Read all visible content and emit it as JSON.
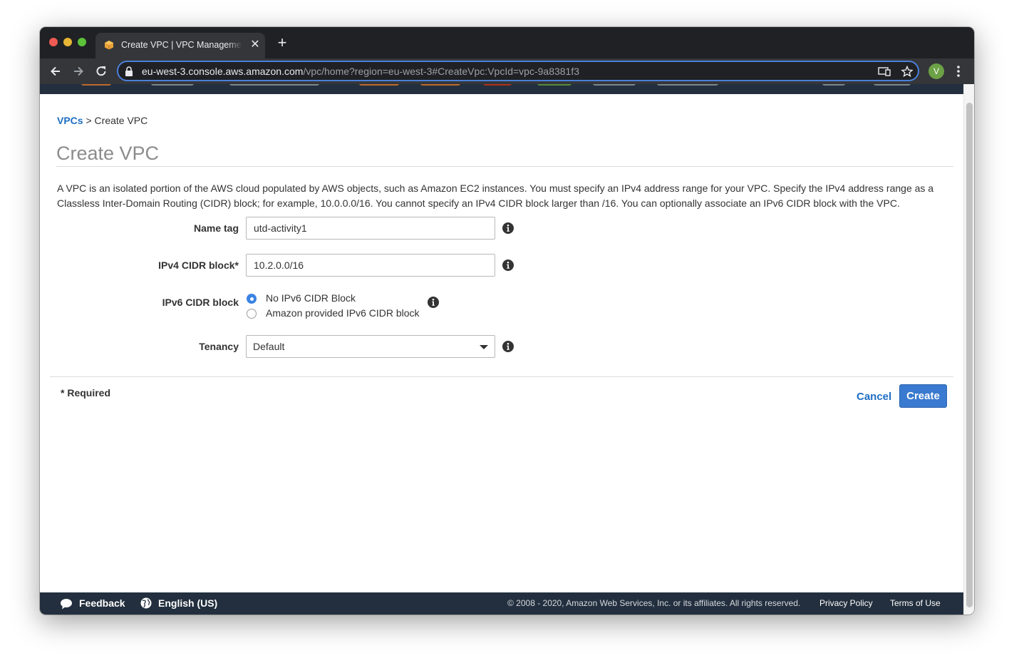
{
  "browser": {
    "tab_title": "Create VPC | VPC Management Console",
    "url_host": "eu-west-3.console.aws.amazon.com",
    "url_path": "/vpc/home?region=eu-west-3#CreateVpc:VpcId=vpc-9a8381f3",
    "profile_initial": "V",
    "new_tab_symbol": "+",
    "close_symbol": "✕"
  },
  "breadcrumb": {
    "parent": "VPCs",
    "separator": ">",
    "current": "Create VPC"
  },
  "page": {
    "title": "Create VPC",
    "description": "A VPC is an isolated portion of the AWS cloud populated by AWS objects, such as Amazon EC2 instances. You must specify an IPv4 address range for your VPC. Specify the IPv4 address range as a Classless Inter-Domain Routing (CIDR) block; for example, 10.0.0.0/16. You cannot specify an IPv4 CIDR block larger than /16. You can optionally associate an IPv6 CIDR block with the VPC."
  },
  "form": {
    "name_tag": {
      "label": "Name tag",
      "value": "utd-activity1"
    },
    "ipv4_cidr": {
      "label": "IPv4 CIDR block*",
      "value": "10.2.0.0/16"
    },
    "ipv6_cidr": {
      "label": "IPv6 CIDR block",
      "options": [
        {
          "label": "No IPv6 CIDR Block",
          "selected": true
        },
        {
          "label": "Amazon provided IPv6 CIDR block",
          "selected": false
        }
      ]
    },
    "tenancy": {
      "label": "Tenancy",
      "value": "Default"
    },
    "required_note": "* Required",
    "cancel_label": "Cancel",
    "create_label": "Create"
  },
  "footer": {
    "feedback": "Feedback",
    "language": "English (US)",
    "copyright": "© 2008 - 2020, Amazon Web Services, Inc. or its affiliates. All rights reserved.",
    "privacy": "Privacy Policy",
    "terms": "Terms of Use"
  },
  "colors": {
    "accent": "#1f6ec4",
    "primary_button": "#3a7ad0",
    "console_nav": "#232f3e",
    "radio_selected": "#3c83e4"
  },
  "icons": [
    "aws-favicon-icon",
    "back-arrow-icon",
    "forward-arrow-icon",
    "reload-icon",
    "lock-icon",
    "cast-icon",
    "star-icon",
    "menu-dots-icon",
    "info-icon",
    "feedback-bubble-icon",
    "globe-icon"
  ]
}
